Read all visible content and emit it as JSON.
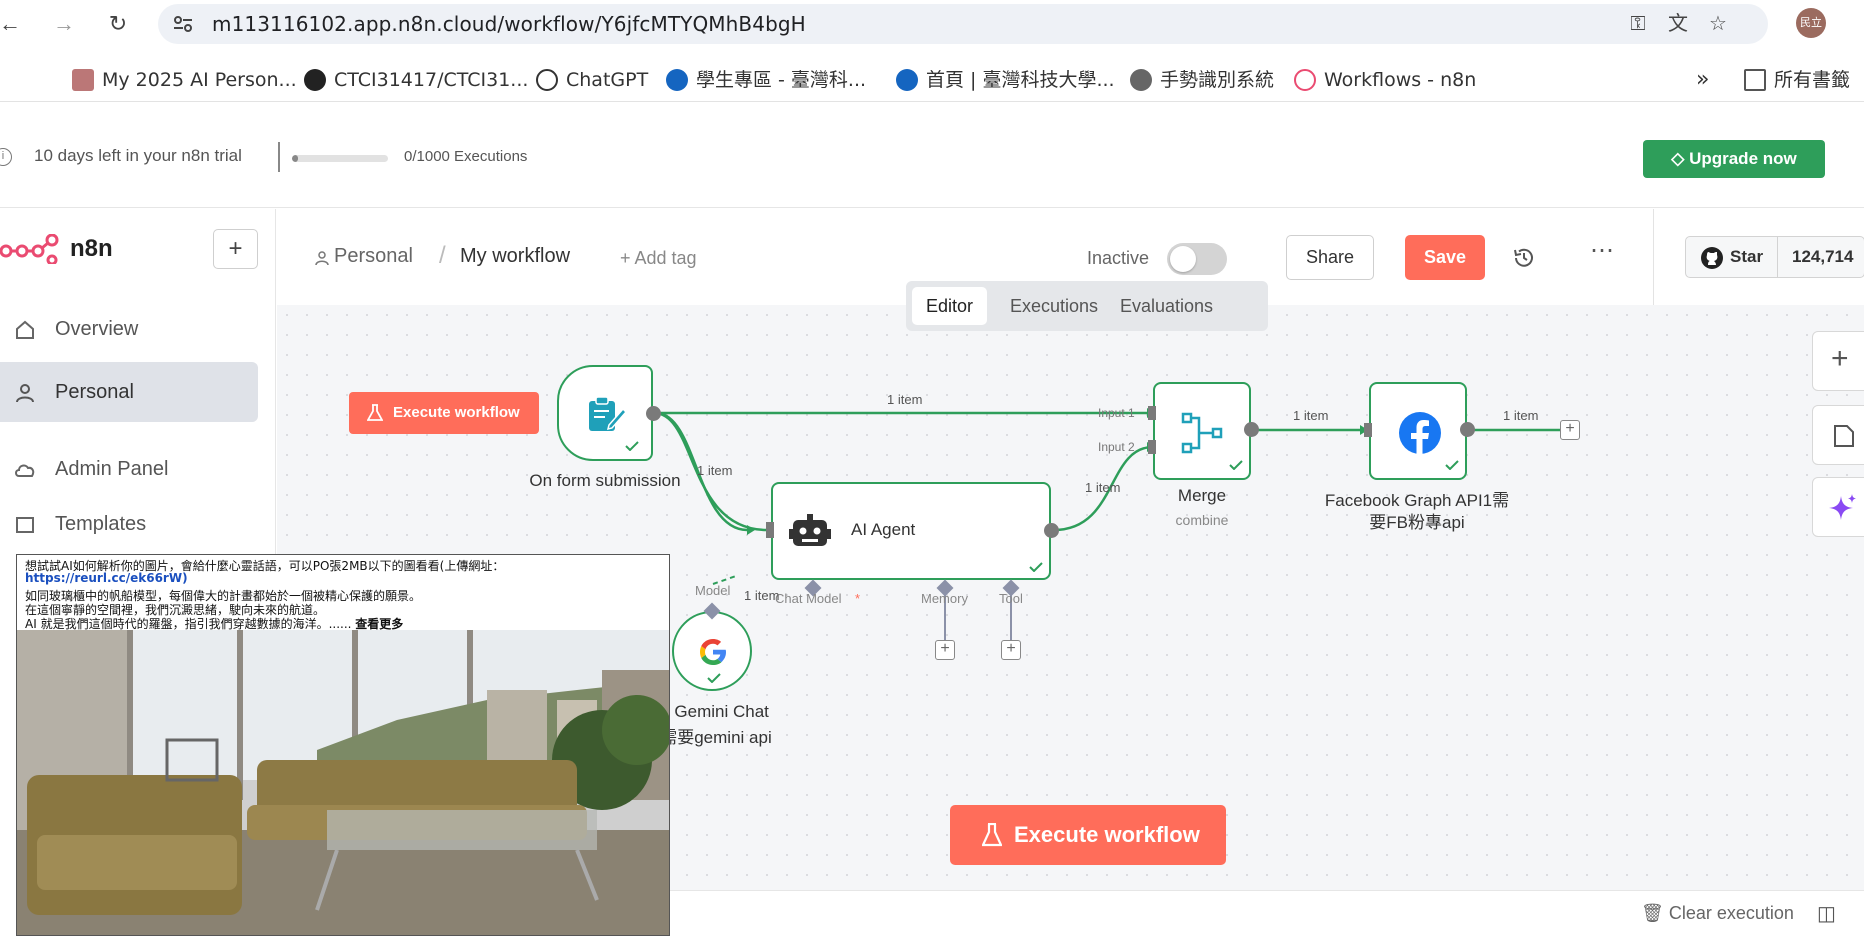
{
  "browser": {
    "url": "m113116102.app.n8n.cloud/workflow/Y6jfcMTYQMhB4bgH",
    "avatar_label": "民立",
    "bookmarks": [
      {
        "label": "My 2025 AI Person..."
      },
      {
        "label": "CTCI31417/CTCI31..."
      },
      {
        "label": "ChatGPT"
      },
      {
        "label": "學生專區 - 臺灣科..."
      },
      {
        "label": "首頁 | 臺灣科技大學..."
      },
      {
        "label": "手勢識別系統"
      },
      {
        "label": "Workflows - n8n"
      },
      {
        "label": "所有書籤"
      }
    ]
  },
  "trial": {
    "message": "10 days left in your n8n trial",
    "executions_label": "0/1000 Executions",
    "executions_used_fraction": 0.0,
    "upgrade_label": "Upgrade now"
  },
  "sidebar": {
    "brand": "n8n",
    "items": [
      {
        "label": "Overview"
      },
      {
        "label": "Personal"
      },
      {
        "label": "Admin Panel"
      },
      {
        "label": "Templates"
      }
    ]
  },
  "header": {
    "breadcrumb_project": "Personal",
    "workflow_name": "My workflow",
    "add_tag": "+ Add tag",
    "status": "Inactive",
    "share": "Share",
    "save": "Save",
    "star": "Star",
    "star_count": "124,714"
  },
  "tabs": [
    "Editor",
    "Executions",
    "Evaluations"
  ],
  "canvas": {
    "execute_small": "Execute workflow",
    "execute_big": "Execute workflow",
    "nodes": {
      "form": {
        "label": "On form submission"
      },
      "agent": {
        "label": "AI Agent",
        "ports": [
          "Chat Model",
          "Memory",
          "Tool"
        ],
        "required_mark": "*"
      },
      "merge": {
        "label": "Merge",
        "sub": "combine",
        "inputs": [
          "Input 1",
          "Input 2"
        ]
      },
      "facebook": {
        "label1": "Facebook Graph API1需",
        "label2": "要FB粉專api"
      },
      "gemini": {
        "label1": "gle Gemini Chat",
        "label2": "el需要gemini api",
        "port": "Model"
      }
    },
    "edge_labels": [
      "1 item",
      "1 item",
      "1 item",
      "1 item",
      "1 item",
      "1 item"
    ],
    "edge_label_gemini": "1 item"
  },
  "footer": {
    "clear_execution": "Clear execution"
  },
  "popup": {
    "line1": "想試試AI如何解析你的圖片，會給什麼心靈話語，可以PO張2MB以下的圖看看(上傳網址：",
    "link": "https://reurl.cc/ek66rW)",
    "line2": "如同玻璃櫃中的帆船模型，每個偉大的計畫都始於一個被精心保護的願景。",
    "line3": "在這個寧靜的空間裡，我們沉澱思緒，駛向未來的航道。",
    "line4": "AI 就是我們這個時代的羅盤，指引我們穿越數據的海洋。......",
    "more": "查看更多"
  },
  "colors": {
    "accent": "#ff6d5a",
    "success": "#2e9e5a",
    "canvas_bg": "#f5f6f8"
  }
}
